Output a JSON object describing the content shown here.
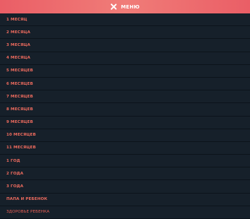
{
  "header": {
    "title": "МЕНЮ",
    "close_icon": "close-icon",
    "gradient_colors": [
      "#ea5e66",
      "#f07c78"
    ]
  },
  "menu": {
    "item_color": "#ee6b5e",
    "background": "#16202a",
    "items": [
      {
        "label": "1 МЕСЯЦ"
      },
      {
        "label": "2 МЕСЯЦА"
      },
      {
        "label": "3 МЕСЯЦА"
      },
      {
        "label": "4 МЕСЯЦА"
      },
      {
        "label": "5 МЕСЯЦЕВ"
      },
      {
        "label": "6 МЕСЯЦЕВ"
      },
      {
        "label": "7 МЕСЯЦЕВ"
      },
      {
        "label": "8 МЕСЯЦЕВ"
      },
      {
        "label": "9 МЕСЯЦЕВ"
      },
      {
        "label": "10 МЕСЯЦЕВ"
      },
      {
        "label": "11 МЕСЯЦЕВ"
      },
      {
        "label": "1 ГОД"
      },
      {
        "label": "2 ГОДА"
      },
      {
        "label": "3 ГОДА"
      },
      {
        "label": "ПАПА И РЕБЕНОК"
      },
      {
        "label": "ЗДОРОВЬЕ РЕБЕНКА"
      }
    ]
  }
}
